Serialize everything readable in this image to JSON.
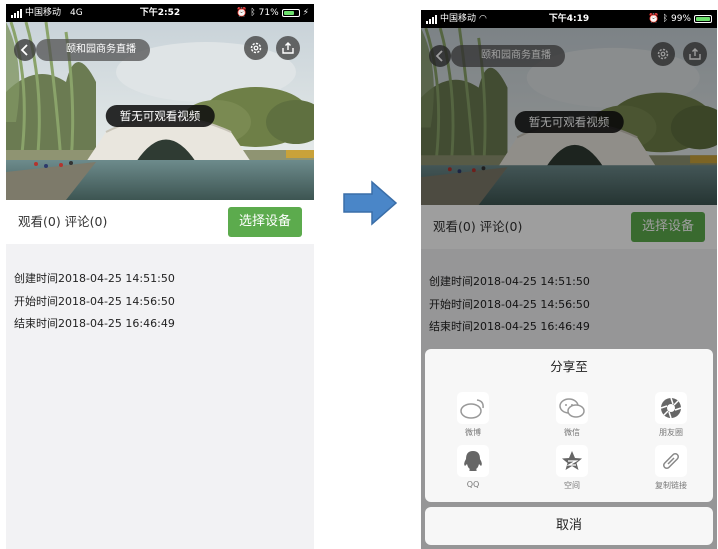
{
  "before": {
    "status": {
      "carrier": "中国移动",
      "network": "4G",
      "time": "下午2:52",
      "battery": "71%",
      "battery_level": 0.71
    },
    "live_title": "颐和园商务直播",
    "no_video": "暂无可观看视频",
    "counts": "观看(0) 评论(0)",
    "select_device": "选择设备",
    "details": [
      "创建时间2018-04-25 14:51:50",
      "开始时间2018-04-25 14:56:50",
      "结束时间2018-04-25 16:46:49"
    ]
  },
  "after": {
    "status": {
      "carrier": "中国移动",
      "time": "下午4:19",
      "battery": "99%",
      "battery_level": 0.99
    },
    "live_title": "颐和园商务直播",
    "no_video": "暂无可观看视频",
    "counts": "观看(0) 评论(0)",
    "select_device": "选择设备",
    "details": [
      "创建时间2018-04-25 14:51:50",
      "开始时间2018-04-25 14:56:50",
      "结束时间2018-04-25 16:46:49"
    ],
    "share": {
      "title": "分享至",
      "items": [
        {
          "label": "微博",
          "icon": "weibo-icon"
        },
        {
          "label": "微信",
          "icon": "wechat-icon"
        },
        {
          "label": "朋友圈",
          "icon": "moments-icon"
        },
        {
          "label": "QQ",
          "icon": "qq-icon"
        },
        {
          "label": "空间",
          "icon": "qzone-icon"
        },
        {
          "label": "复制链接",
          "icon": "link-icon"
        }
      ],
      "cancel": "取消"
    }
  },
  "colors": {
    "accent_green": "#5cab4d",
    "arrow_blue": "#4a86c8",
    "status_bar": "#000000"
  }
}
